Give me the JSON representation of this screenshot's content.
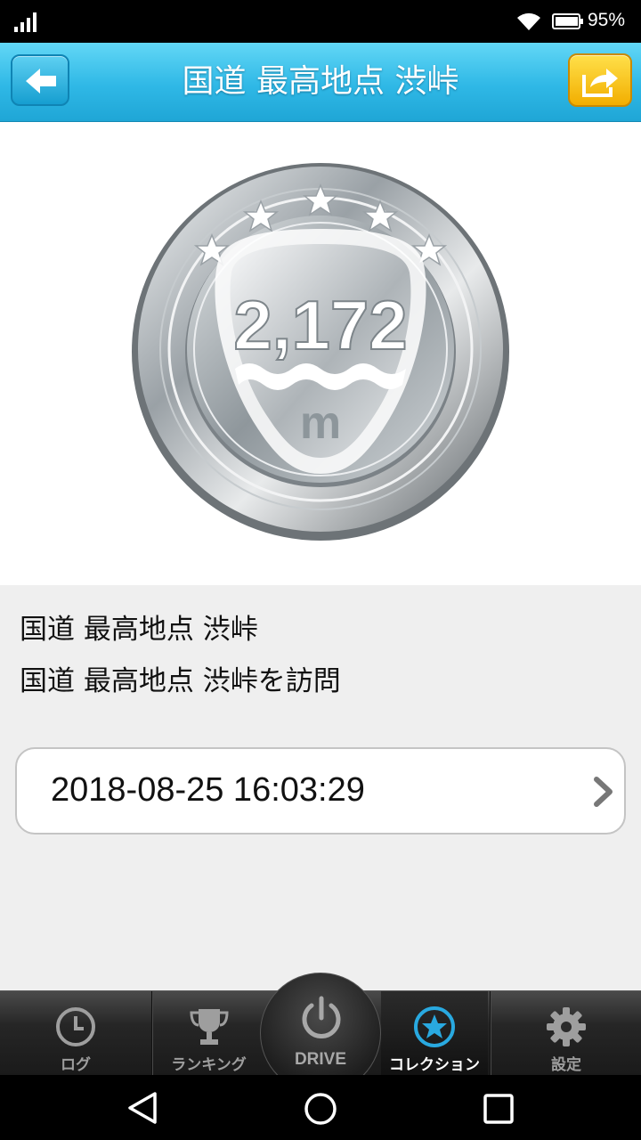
{
  "status": {
    "battery_text": "95%"
  },
  "header": {
    "title": "国道 最高地点 渋峠",
    "back_icon": "back-arrow-icon",
    "share_icon": "share-icon"
  },
  "medal": {
    "value": "2,172",
    "unit": "m",
    "stars": 5,
    "color": "#b8bec4"
  },
  "info": {
    "name": "国道 最高地点 渋峠",
    "description": "国道 最高地点 渋峠を訪問",
    "log_date": "2018-08-25 16:03:29"
  },
  "tabs": [
    {
      "label": "ログ",
      "icon": "clock-icon"
    },
    {
      "label": "ランキング",
      "icon": "trophy-icon"
    },
    {
      "label": "DRIVE",
      "icon": "power-icon"
    },
    {
      "label": "コレクション",
      "icon": "star-icon"
    },
    {
      "label": "設定",
      "icon": "gear-icon"
    }
  ],
  "active_tab": "コレクション",
  "colors": {
    "header": "#2fb8e6",
    "share_button": "#f5b800",
    "active_tab_icon": "#29a9e0"
  }
}
